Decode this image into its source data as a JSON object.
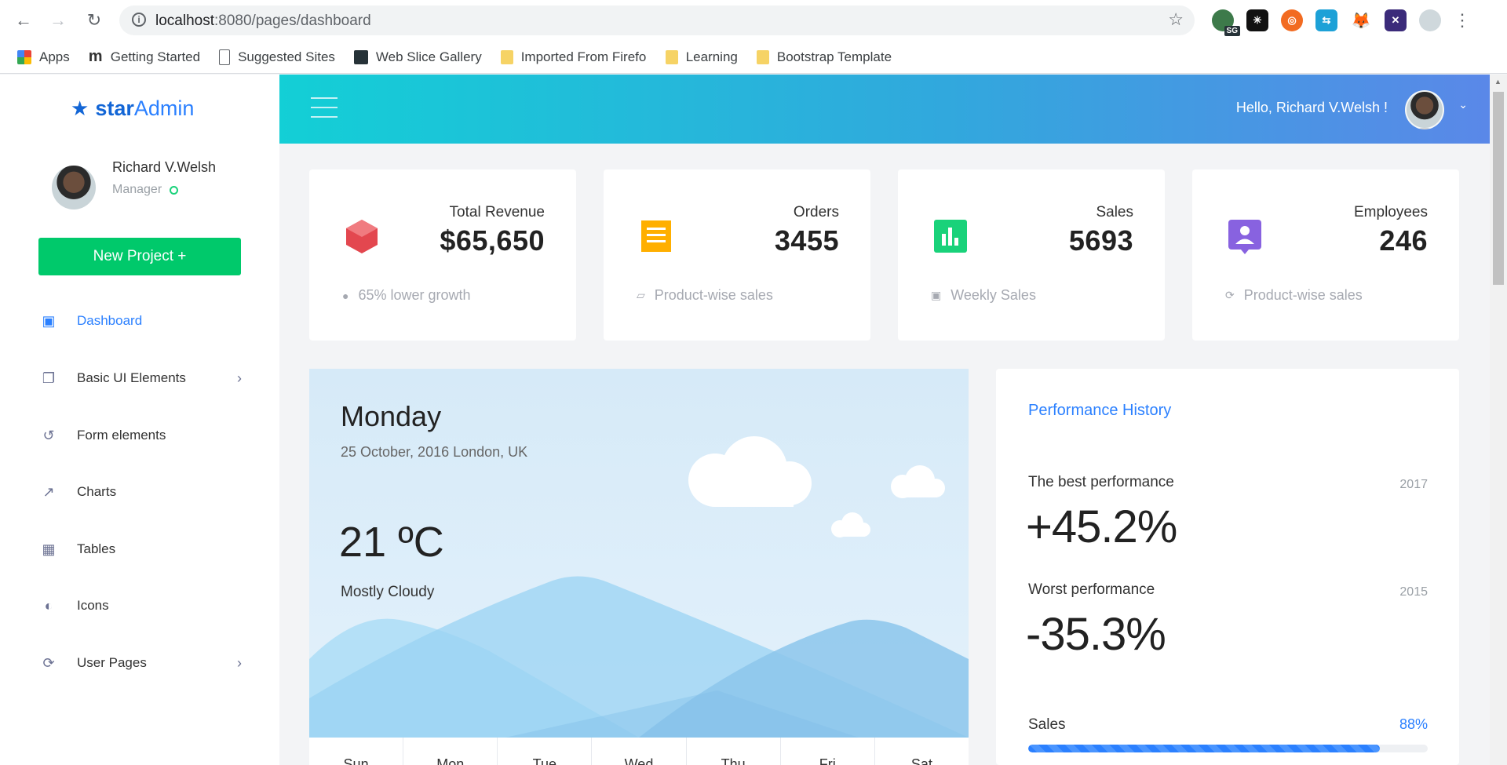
{
  "browser": {
    "url_host": "localhost",
    "url_rest": ":8080/pages/dashboard",
    "bookmarks": [
      {
        "label": "Apps",
        "icon": "apps-grid-icon"
      },
      {
        "label": "Getting Started",
        "icon": "m-logo-icon"
      },
      {
        "label": "Suggested Sites",
        "icon": "page-icon"
      },
      {
        "label": "Web Slice Gallery",
        "icon": "web-slice-icon"
      },
      {
        "label": "Imported From Firefo",
        "icon": "folder-icon"
      },
      {
        "label": "Learning",
        "icon": "folder-icon"
      },
      {
        "label": "Bootstrap Template",
        "icon": "folder-icon"
      }
    ],
    "extension_badge": "SG"
  },
  "brand": {
    "prefix": "star",
    "suffix": "Admin"
  },
  "profile": {
    "name": "Richard V.Welsh",
    "role": "Manager"
  },
  "new_project_label": "New Project +",
  "nav": [
    {
      "label": "Dashboard",
      "icon": "monitor-icon",
      "active": true
    },
    {
      "label": "Basic UI Elements",
      "icon": "copy-icon",
      "chevron": true
    },
    {
      "label": "Form elements",
      "icon": "history-icon"
    },
    {
      "label": "Charts",
      "icon": "chart-line-icon"
    },
    {
      "label": "Tables",
      "icon": "table-icon"
    },
    {
      "label": "Icons",
      "icon": "sticker-icon"
    },
    {
      "label": "User Pages",
      "icon": "restore-icon",
      "chevron": true
    }
  ],
  "header": {
    "greeting": "Hello, Richard V.Welsh !"
  },
  "stats": [
    {
      "title": "Total Revenue",
      "value": "$65,650",
      "foot": "65% lower growth",
      "color": "#e3474f",
      "icon": "cube-icon",
      "foot_icon": "alert-circle-icon"
    },
    {
      "title": "Orders",
      "value": "3455",
      "foot": "Product-wise sales",
      "color": "#ffaf00",
      "icon": "receipt-icon",
      "foot_icon": "bookmark-icon"
    },
    {
      "title": "Sales",
      "value": "5693",
      "foot": "Weekly Sales",
      "color": "#19d27a",
      "icon": "poll-box-icon",
      "foot_icon": "calendar-icon"
    },
    {
      "title": "Employees",
      "value": "246",
      "foot": "Product-wise sales",
      "color": "#8862e0",
      "icon": "account-box-icon",
      "foot_icon": "reload-icon"
    }
  ],
  "weather": {
    "day": "Monday",
    "date_location": "25 October, 2016 London, UK",
    "temperature": "21 ºC",
    "condition": "Mostly Cloudy",
    "days": [
      "Sun",
      "Mon",
      "Tue",
      "Wed",
      "Thu",
      "Fri",
      "Sat"
    ]
  },
  "performance": {
    "title": "Performance History",
    "best_label": "The best performance",
    "best_year": "2017",
    "best_value": "+45.2%",
    "worst_label": "Worst performance",
    "worst_year": "2015",
    "worst_value": "-35.3%",
    "sales_label": "Sales",
    "sales_percent_text": "88%",
    "sales_fraction": 0.88
  },
  "colors": {
    "accent": "#2b80ff",
    "success": "#19d27a",
    "brand_star": "#1366d6"
  }
}
